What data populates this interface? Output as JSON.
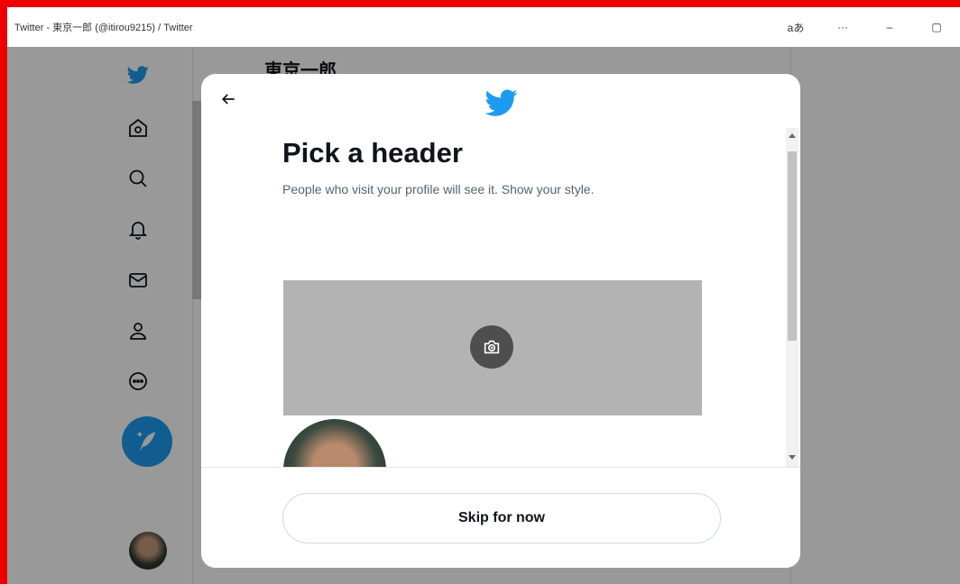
{
  "window": {
    "title": "Twitter - 東京一郎 (@itirou9215) / Twitter",
    "controls": [
      "aあ",
      "···",
      "–",
      "▢"
    ]
  },
  "colors": {
    "accent": "#1d9bf0",
    "frame": "#ee0000"
  },
  "sidebar": {
    "icons": [
      "twitter-logo-icon",
      "home-icon",
      "search-icon",
      "notifications-icon",
      "messages-icon",
      "profile-icon",
      "more-icon"
    ],
    "compose_icon": "compose-tweet-icon"
  },
  "profile_header": {
    "name": "東京一郎"
  },
  "modal": {
    "title": "Pick a header",
    "subtitle": "People who visit your profile will see it. Show your style.",
    "skip_label": "Skip for now"
  }
}
